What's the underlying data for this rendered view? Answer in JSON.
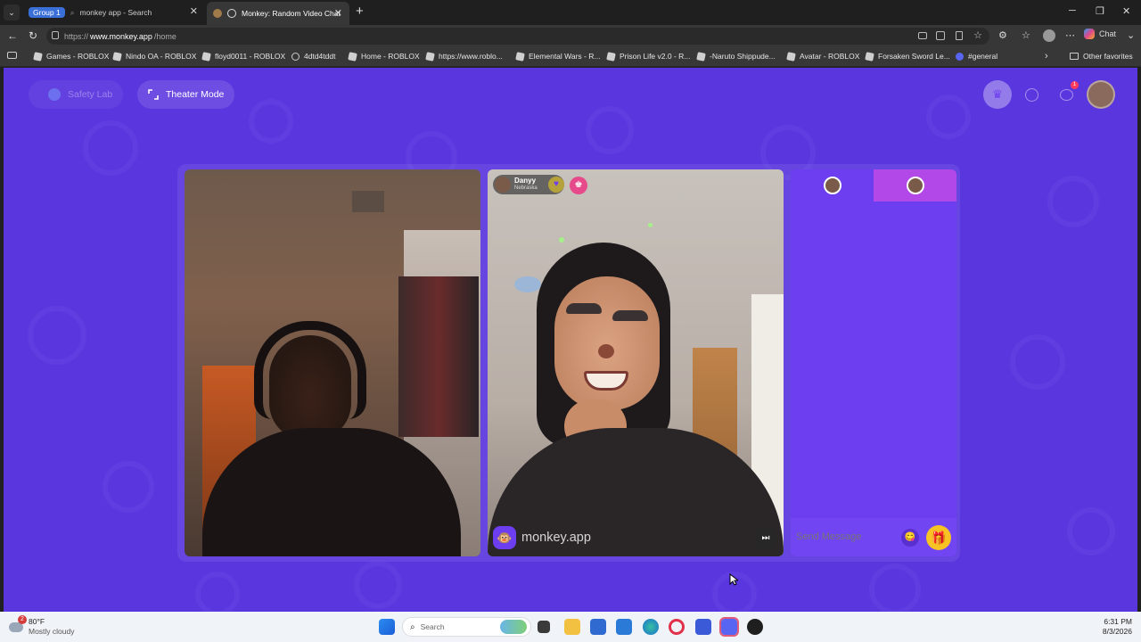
{
  "browser": {
    "tabs": [
      {
        "group_label": "Group 1",
        "title": "monkey app - Search"
      },
      {
        "title": "Monkey: Random Video Chat"
      }
    ],
    "url_prefix": "https://",
    "url_domain": "www.monkey.app",
    "url_path": "/home",
    "profile_label": "Chat",
    "bookmarks": [
      "Games - ROBLOX",
      "Nindo OA - ROBLOX",
      "floyd0011 - ROBLOX",
      "4dtd4tddt",
      "Home - ROBLOX",
      "https://www.roblo...",
      "Elemental Wars - R...",
      "Prison Life v2.0 - R...",
      "-Naruto Shippude...",
      "Avatar - ROBLOX",
      "Forsaken Sword Le...",
      "#general"
    ],
    "other_favorites": "Other favorites"
  },
  "app": {
    "safety_lab": "Safety Lab",
    "theater_mode": "Theater Mode",
    "notif_count": "1",
    "partner": {
      "name": "Danyy",
      "location": "Nebraska"
    },
    "watermark": "monkey.app",
    "chat_placeholder": "Send Message"
  },
  "taskbar": {
    "weather_badge": "2",
    "temperature": "80°F",
    "condition": "Mostly cloudy",
    "search_label": "Search",
    "time": "6:31 PM",
    "date": "8/3/2026"
  },
  "colors": {
    "page_bg": "#5a36df",
    "accent": "#6d3df0",
    "tab_pink": "#b248e8"
  }
}
